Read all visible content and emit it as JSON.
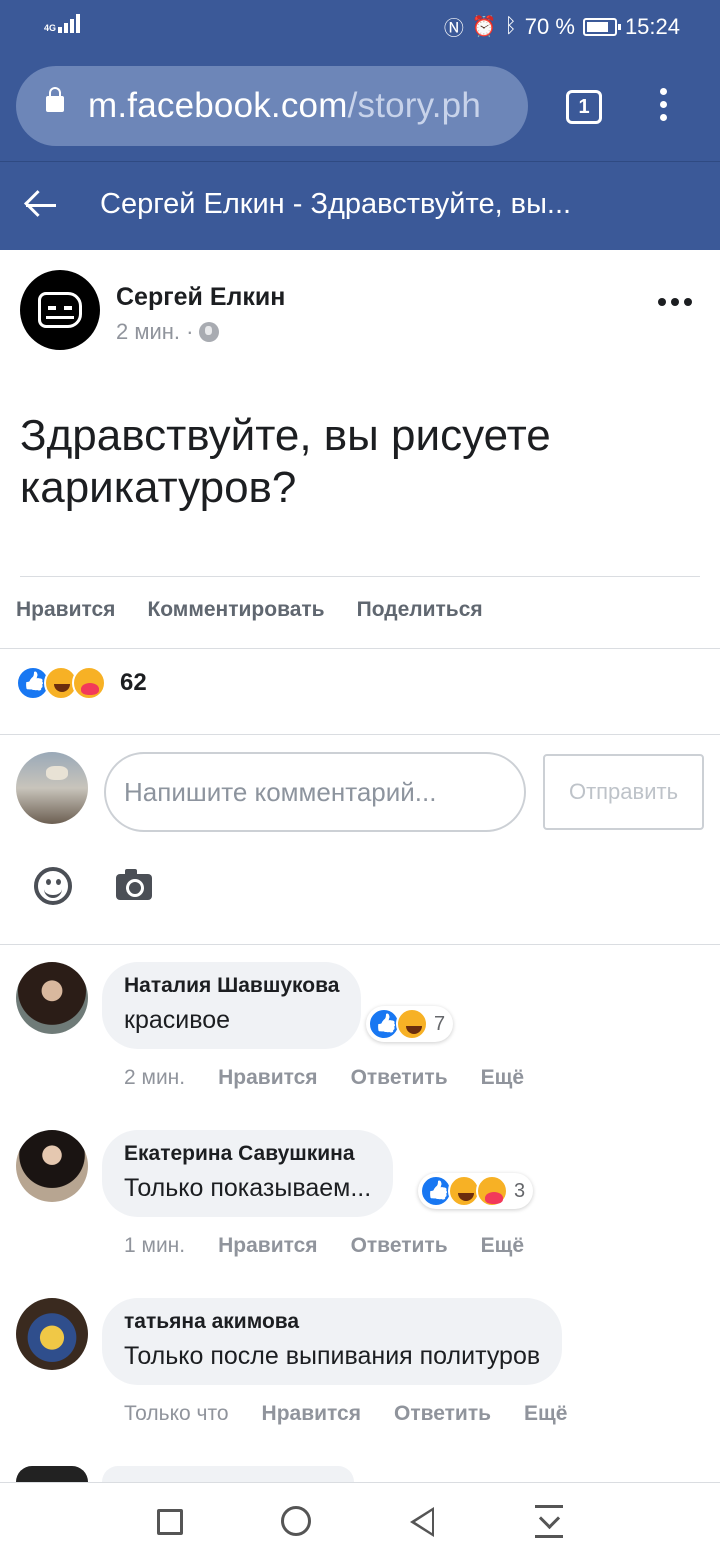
{
  "status_bar": {
    "network": "4G",
    "battery": "70 %",
    "time": "15:24",
    "icons": [
      "nfc-icon",
      "alarm-icon",
      "bluetooth-icon",
      "battery-icon"
    ]
  },
  "browser": {
    "url_domain": "m.facebook.com",
    "url_path": "/story.ph",
    "tab_count": "1"
  },
  "header": {
    "title": "Сергей Елкин - Здравствуйте, вы..."
  },
  "post": {
    "author": "Сергей Елкин",
    "time": "2 мин. ·",
    "text": "Здравствуйте, вы рисуете карикатуров?",
    "actions": {
      "like": "Нравится",
      "comment": "Комментировать",
      "share": "Поделиться"
    },
    "reaction_count": "62"
  },
  "compose": {
    "placeholder": "Напишите комментарий...",
    "send": "Отправить"
  },
  "comments": [
    {
      "name": "Наталия Шавшукова",
      "text": "красивое",
      "reactions": "7",
      "time": "2 мин.",
      "like": "Нравится",
      "reply": "Ответить",
      "more": "Ещё"
    },
    {
      "name": "Екатерина Савушкина",
      "text": "Только показываем...",
      "reactions": "3",
      "time": "1 мин.",
      "like": "Нравится",
      "reply": "Ответить",
      "more": "Ещё"
    },
    {
      "name": "татьяна акимова",
      "text": "Только после выпивания политуров",
      "time": "Только что",
      "like": "Нравится",
      "reply": "Ответить",
      "more": "Ещё"
    }
  ],
  "colors": {
    "brand": "#3b5998",
    "like_blue": "#1877f2",
    "haha_yellow": "#f7b125",
    "text_dark": "#1c1e21",
    "muted": "#90949c"
  }
}
